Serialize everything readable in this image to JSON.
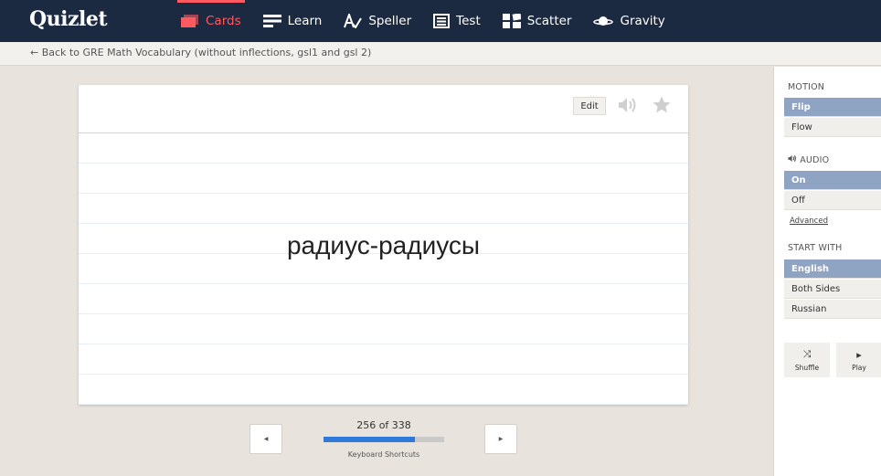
{
  "app": {
    "logo": "Quizlet"
  },
  "nav": [
    {
      "label": "Cards",
      "icon": "cards-icon",
      "active": true
    },
    {
      "label": "Learn",
      "icon": "learn-icon",
      "active": false
    },
    {
      "label": "Speller",
      "icon": "speller-icon",
      "active": false
    },
    {
      "label": "Test",
      "icon": "test-icon",
      "active": false
    },
    {
      "label": "Scatter",
      "icon": "scatter-icon",
      "active": false
    },
    {
      "label": "Gravity",
      "icon": "gravity-icon",
      "active": false
    }
  ],
  "breadcrumb": {
    "back_label": "← Back to GRE Math Vocabulary (without inflections, gsl1 and gsl 2)"
  },
  "card": {
    "edit_label": "Edit",
    "term": "радиус-радиусы"
  },
  "controls": {
    "prev_label": "◀",
    "next_label": "▶",
    "counter": "256 of 338",
    "progress": 0.757,
    "shortcuts_label": "Keyboard Shortcuts"
  },
  "sidebar": {
    "motion": {
      "label": "MOTION",
      "options": [
        "Flip",
        "Flow"
      ],
      "selected": "Flip"
    },
    "audio": {
      "label": "AUDIO",
      "options": [
        "On",
        "Off"
      ],
      "selected": "On",
      "advanced_label": "Advanced"
    },
    "start_with": {
      "label": "START WITH",
      "options": [
        "English",
        "Both Sides",
        "Russian"
      ],
      "selected": "English"
    },
    "tools": {
      "shuffle_label": "Shuffle",
      "play_label": "Play"
    }
  },
  "colors": {
    "topbar": "#1b2a41",
    "accent": "#ff5a5f",
    "progress": "#2f7ad9",
    "selected": "#8fa3c2"
  }
}
